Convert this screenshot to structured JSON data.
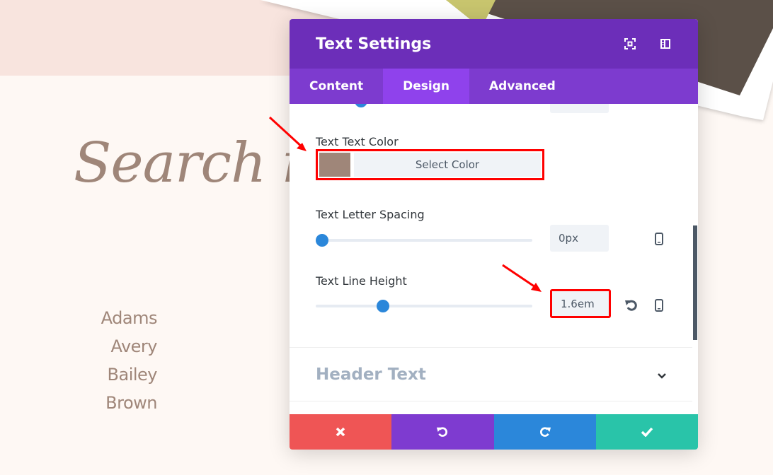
{
  "page": {
    "headline": "Search ima",
    "names": [
      "Adams",
      "Avery",
      "Bailey",
      "Brown"
    ]
  },
  "modal": {
    "title": "Text Settings",
    "header_icons": [
      "fullscreen-icon",
      "sidebar-dock-icon"
    ],
    "tabs": [
      {
        "label": "Content"
      },
      {
        "label": "Design",
        "active": true
      },
      {
        "label": "Advanced"
      }
    ],
    "text_color": {
      "label": "Text Text Color",
      "swatch": "#9f8679",
      "button": "Select Color"
    },
    "letter_spacing": {
      "label": "Text Letter Spacing",
      "value": "0px",
      "slider_percent": 0
    },
    "line_height": {
      "label": "Text Line Height",
      "value": "1.6em",
      "slider_percent": 30
    },
    "section": {
      "label": "Header Text"
    },
    "footer": [
      {
        "name": "cancel",
        "icon": "close-icon",
        "color": "#ef5555"
      },
      {
        "name": "undo",
        "icon": "undo-icon",
        "color": "#7e3bd0"
      },
      {
        "name": "redo",
        "icon": "redo-icon",
        "color": "#2b87da"
      },
      {
        "name": "save",
        "icon": "check-icon",
        "color": "#29c4a9"
      }
    ]
  },
  "colors": {
    "header": "#6c2eb9",
    "tabs": "#7d3bcf",
    "active_tab": "#8f42ec",
    "highlight": "#ff0000"
  }
}
